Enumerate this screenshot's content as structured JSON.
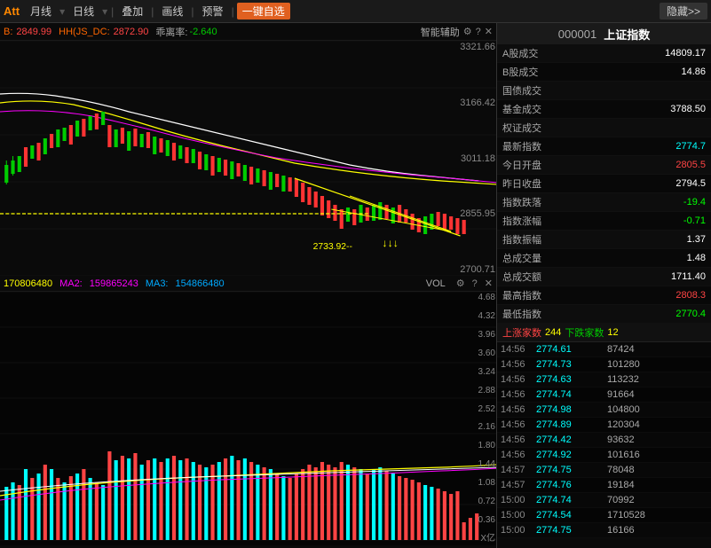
{
  "topbar": {
    "items": [
      {
        "label": "月线",
        "active": false
      },
      {
        "label": "日线",
        "active": false
      },
      {
        "label": "叠加",
        "active": false
      },
      {
        "label": "画线",
        "active": false
      },
      {
        "label": "预警",
        "active": false
      },
      {
        "label": "一键自选",
        "active": true
      }
    ],
    "hide_label": "隐藏>>"
  },
  "chart_info": {
    "label1": "B:",
    "val1": "2849.99",
    "label2": "HH(JS_DC:",
    "val2": "2872.90",
    "label3": "乖离率:",
    "val3": "-2.640",
    "ai_label": "智能辅助"
  },
  "y_labels": [
    "3321.66",
    "3166.42",
    "3011.18",
    "2855.95",
    "2700.71"
  ],
  "annotations": {
    "price1": "2733.92--",
    "arrows": "↓↓↓"
  },
  "ma_info": {
    "label": "170806480",
    "ma2_label": "MA2:",
    "ma2_val": "159865243",
    "ma3_label": "MA3:",
    "ma3_val": "154866480",
    "vol_label": "VOL"
  },
  "vol_y_labels": [
    "4.68",
    "4.32",
    "3.96",
    "3.60",
    "3.24",
    "2.88",
    "2.52",
    "2.16",
    "1.80",
    "1.44",
    "1.08",
    "0.72",
    "0.36",
    "X亿"
  ],
  "stock": {
    "code": "000001",
    "name": "上证指数"
  },
  "stats": [
    {
      "label": "A股成交",
      "val": "14809.17",
      "color": "white"
    },
    {
      "label": "B股成交",
      "val": "14.86",
      "color": "white"
    },
    {
      "label": "国债成交",
      "val": "",
      "color": "white"
    },
    {
      "label": "基金成交",
      "val": "3788.50",
      "color": "white"
    },
    {
      "label": "权证成交",
      "val": "",
      "color": "white"
    },
    {
      "label": "",
      "val": "",
      "color": "white"
    },
    {
      "label": "最新指数",
      "val": "2774.7",
      "color": "cyan"
    },
    {
      "label": "今日开盘",
      "val": "2805.5",
      "color": "red"
    },
    {
      "label": "昨日收盘",
      "val": "2794.5",
      "color": "white"
    },
    {
      "label": "指数跌落",
      "val": "-19.4",
      "color": "green"
    },
    {
      "label": "指数涨幅",
      "val": "-0.71",
      "color": "green"
    },
    {
      "label": "指数振幅",
      "val": "1.37",
      "color": "white"
    },
    {
      "label": "总成交量",
      "val": "1.48",
      "color": "white"
    },
    {
      "label": "",
      "val": "",
      "color": "white"
    },
    {
      "label": "总成交额",
      "val": "1711.40",
      "color": "white"
    },
    {
      "label": "",
      "val": "",
      "color": "white"
    },
    {
      "label": "最高指数",
      "val": "2808.3",
      "color": "red"
    },
    {
      "label": "",
      "val": "",
      "color": "white"
    },
    {
      "label": "最低指数",
      "val": "2770.4",
      "color": "green"
    },
    {
      "label": "",
      "val": "",
      "color": "white"
    }
  ],
  "trade_header": {
    "up_label": "上涨家数",
    "up_count": "244",
    "down_label": "下跌家数",
    "down_count": "12"
  },
  "trades": [
    {
      "time": "14:56",
      "price": "2774.61",
      "vol": "87424"
    },
    {
      "time": "14:56",
      "price": "2774.73",
      "vol": "101280"
    },
    {
      "time": "14:56",
      "price": "2774.63",
      "vol": "113232"
    },
    {
      "time": "14:56",
      "price": "2774.74",
      "vol": "91664"
    },
    {
      "time": "14:56",
      "price": "2774.98",
      "vol": "104800"
    },
    {
      "time": "14:56",
      "price": "2774.89",
      "vol": "120304"
    },
    {
      "time": "14:56",
      "price": "2774.42",
      "vol": "93632"
    },
    {
      "time": "14:56",
      "price": "2774.92",
      "vol": "101616"
    },
    {
      "time": "14:57",
      "price": "2774.75",
      "vol": "78048"
    },
    {
      "time": "14:57",
      "price": "2774.76",
      "vol": "19184"
    },
    {
      "time": "15:00",
      "price": "2774.74",
      "vol": "70992"
    },
    {
      "time": "15:00",
      "price": "2774.54",
      "vol": "1710528"
    },
    {
      "time": "15:00",
      "price": "2774.75",
      "vol": "16166"
    }
  ]
}
